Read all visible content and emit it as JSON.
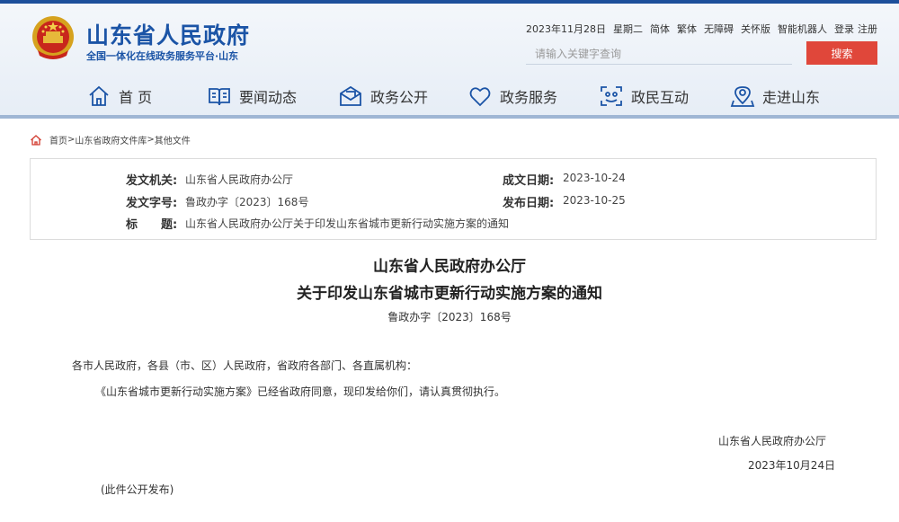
{
  "colors": {
    "brand_blue": "#1b54a6",
    "search_button": "#e0473a",
    "header_bg": "#e6edf6"
  },
  "header": {
    "title": "山东省人民政府",
    "subtitle": "全国一体化在线政务服务平台·山东",
    "emblem_icon": "national-emblem-icon"
  },
  "util": {
    "date": "2023年11月28日",
    "weekday": "星期二",
    "simplified": "简体",
    "traditional": "繁体",
    "accessibility": "无障碍",
    "care_version": "关怀版",
    "robot": "智能机器人",
    "login": "登录",
    "register": "注册"
  },
  "search": {
    "placeholder": "请输入关键字查询",
    "button": "搜索"
  },
  "nav": [
    {
      "label": "首 页",
      "icon": "home-icon"
    },
    {
      "label": "要闻动态",
      "icon": "book-icon"
    },
    {
      "label": "政务公开",
      "icon": "mail-icon"
    },
    {
      "label": "政务服务",
      "icon": "heart-icon"
    },
    {
      "label": "政民互动",
      "icon": "interaction-icon"
    },
    {
      "label": "走进山东",
      "icon": "location-icon"
    }
  ],
  "breadcrumb": {
    "home": "首页",
    "sep": ">",
    "library": "山东省政府文件库",
    "current": "其他文件"
  },
  "meta": {
    "issuer_label": "发文机关:",
    "issuer": "山东省人民政府办公厅",
    "doc_no_label": "发文字号:",
    "doc_no": "鲁政办字〔2023〕168号",
    "title_label": "标　　题:",
    "title": "山东省人民政府办公厅关于印发山东省城市更新行动实施方案的通知",
    "created_label": "成文日期:",
    "created": "2023-10-24",
    "published_label": "发布日期:",
    "published": "2023-10-25"
  },
  "document": {
    "title_line1": "山东省人民政府办公厅",
    "title_line2": "关于印发山东省城市更新行动实施方案的通知",
    "number": "鲁政办字〔2023〕168号",
    "recipients": "各市人民政府，各县（市、区）人民政府，省政府各部门、各直属机构：",
    "body": "《山东省城市更新行动实施方案》已经省政府同意，现印发给你们，请认真贯彻执行。",
    "signature": "山东省人民政府办公厅",
    "date": "2023年10月24日",
    "note": "(此件公开发布)"
  }
}
